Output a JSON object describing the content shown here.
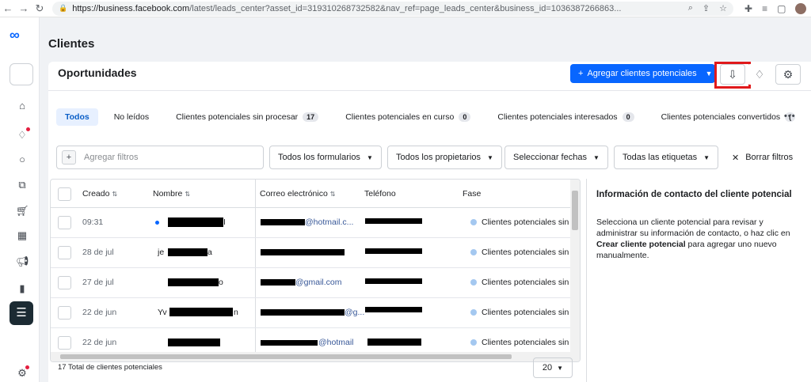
{
  "browser": {
    "url_host": "https://business.facebook.com",
    "url_path": "/latest/leads_center?asset_id=319310268732582&nav_ref=page_leads_center&business_id=1036387266863..."
  },
  "page": {
    "title": "Clientes",
    "section_title": "Oportunidades"
  },
  "toolbar": {
    "add_label": "Agregar clientes potenciales"
  },
  "tabs": [
    {
      "label": "Todos",
      "count": ""
    },
    {
      "label": "No leídos",
      "count": ""
    },
    {
      "label": "Clientes potenciales sin procesar",
      "count": "17"
    },
    {
      "label": "Clientes potenciales en curso",
      "count": "0"
    },
    {
      "label": "Clientes potenciales interesados",
      "count": "0"
    },
    {
      "label": "Clientes potenciales convertidos",
      "count": "("
    }
  ],
  "filters": {
    "search_placeholder": "Agregar filtros",
    "forms": "Todos los formularios",
    "owners": "Todos los propietarios",
    "dates": "Seleccionar fechas",
    "tags": "Todas las etiquetas",
    "clear": "Borrar filtros"
  },
  "table": {
    "headers": {
      "created": "Creado",
      "name": "Nombre",
      "email": "Correo electrónico",
      "phone": "Teléfono",
      "stage": "Fase"
    },
    "rows": [
      {
        "created": "09:31",
        "name_suffix": "I",
        "email_suffix": "@hotmail.c...",
        "stage": "Clientes potenciales sin"
      },
      {
        "created": "28 de jul",
        "name_prefix": "je",
        "name_suffix": "a",
        "stage": "Clientes potenciales sin"
      },
      {
        "created": "27 de jul",
        "name_suffix": "o",
        "email_suffix": "@gmail.com",
        "stage": "Clientes potenciales sin"
      },
      {
        "created": "22 de jun",
        "name_prefix": "Yv",
        "name_suffix": "n",
        "email_suffix": "@g...",
        "stage": "Clientes potenciales sin"
      },
      {
        "created": "22 de jun",
        "email_suffix": "@hotmail",
        "stage": "Clientes potenciales sin"
      }
    ]
  },
  "footer": {
    "total": "17 Total de clientes potenciales",
    "page_size": "20"
  },
  "detail": {
    "title": "Información de contacto del cliente potencial",
    "body_1": "Selecciona un cliente potencial para revisar y administrar su información de contacto, o haz clic en",
    "body_bold": "Crear cliente potencial",
    "body_2": "para agregar uno nuevo manualmente."
  }
}
